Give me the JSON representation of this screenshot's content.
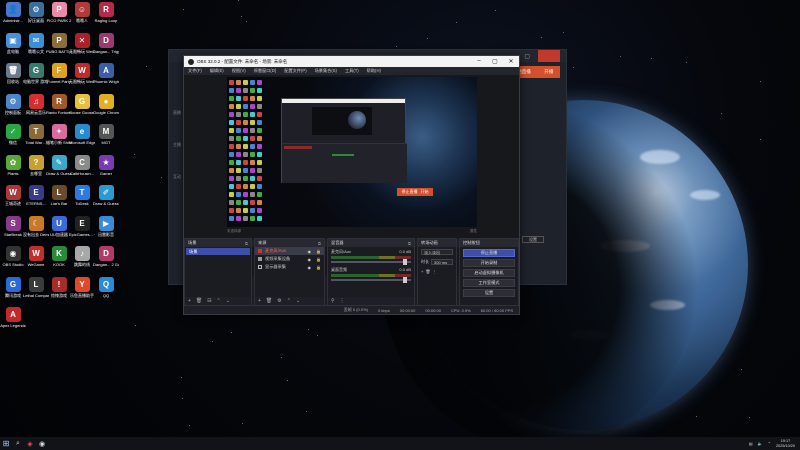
{
  "desktop": {
    "icons": [
      {
        "label": "Administr...",
        "glyph": "👤",
        "color": "#4a78c8"
      },
      {
        "label": "好压桌面",
        "glyph": "⚙",
        "color": "#3a6e9e"
      },
      {
        "label": "PICO PARK 2",
        "glyph": "P",
        "color": "#e88aa8"
      },
      {
        "label": "哦哦人",
        "glyph": "☺",
        "color": "#b03a3a"
      },
      {
        "label": "Raging Loop",
        "glyph": "R",
        "color": "#b52a4a"
      },
      {
        "label": "此电脑",
        "glyph": "▣",
        "color": "#4a90d9"
      },
      {
        "label": "哦哦公文",
        "glyph": "✉",
        "color": "#3a8fd6"
      },
      {
        "label": "PUBG BATTLEGR...",
        "glyph": "P",
        "color": "#8a6d3b"
      },
      {
        "label": "无限畅玩 WeGameB...",
        "glyph": "✕",
        "color": "#b0202a"
      },
      {
        "label": "Dangan... Trigger H...",
        "glyph": "D",
        "color": "#9b3a6e"
      },
      {
        "label": "回收站",
        "glyph": "🗑",
        "color": "#6a7a8a"
      },
      {
        "label": "电脑世界 游戏平台",
        "glyph": "G",
        "color": "#3a7a6e"
      },
      {
        "label": "Funmel Party",
        "glyph": "F",
        "color": "#e0a020"
      },
      {
        "label": "无限畅玩 WeGame...",
        "glyph": "W",
        "color": "#c02a2a"
      },
      {
        "label": "Phoenix Wright A...",
        "glyph": "A",
        "color": "#3a5ea8"
      },
      {
        "label": "控制面板",
        "glyph": "⚙",
        "color": "#4a86c8"
      },
      {
        "label": "网易云音乐",
        "glyph": "♫",
        "color": "#d23030"
      },
      {
        "label": "Ranto Fortune ...",
        "glyph": "R",
        "color": "#a05a2a"
      },
      {
        "label": "Goose Goose Duck",
        "glyph": "G",
        "color": "#e8c040"
      },
      {
        "label": "Google Chrome",
        "glyph": "●",
        "color": "#e0b020"
      },
      {
        "label": "微信",
        "glyph": "✓",
        "color": "#2aa845"
      },
      {
        "label": "Total War ...",
        "glyph": "T",
        "color": "#8a6a3a"
      },
      {
        "label": "蜡笔小新 Shifting...",
        "glyph": "✦",
        "color": "#d86aa0"
      },
      {
        "label": "Microsoft Edge",
        "glyph": "e",
        "color": "#2a8ad0"
      },
      {
        "label": "MGT",
        "glyph": "M",
        "color": "#555"
      },
      {
        "label": "Plants",
        "glyph": "✿",
        "color": "#5aa83a"
      },
      {
        "label": "去哪里",
        "glyph": "?",
        "color": "#c8a030"
      },
      {
        "label": "Draw & Guess",
        "glyph": "✎",
        "color": "#3aa8c8"
      },
      {
        "label": "CalbHousin...",
        "glyph": "C",
        "color": "#8a8a8a"
      },
      {
        "label": "Gamer",
        "glyph": "★",
        "color": "#7a3ab0"
      },
      {
        "label": "王城奇迹",
        "glyph": "W",
        "color": "#a83a3a"
      },
      {
        "label": "ETERNS...",
        "glyph": "E",
        "color": "#3a3a8a"
      },
      {
        "label": "Liar's Bar",
        "glyph": "L",
        "color": "#6a4a2a"
      },
      {
        "label": "ToDesk",
        "glyph": "T",
        "color": "#2a7ae0"
      },
      {
        "label": "Draw & Guess -...",
        "glyph": "✐",
        "color": "#2a9ad0"
      },
      {
        "label": "StarBreak",
        "glyph": "S",
        "color": "#8a3a8a"
      },
      {
        "label": "没有出去 Demo",
        "glyph": "☾",
        "color": "#c87a2a"
      },
      {
        "label": "UU加速器",
        "glyph": "U",
        "color": "#3a6ad8"
      },
      {
        "label": "EpicGames... 一站随交互",
        "glyph": "E",
        "color": "#222"
      },
      {
        "label": "迅雷影音",
        "glyph": "▶",
        "color": "#3a8ad8"
      },
      {
        "label": "OBS Studio",
        "glyph": "◉",
        "color": "#333"
      },
      {
        "label": "WeGame",
        "glyph": "W",
        "color": "#c0302a"
      },
      {
        "label": "KOOK",
        "glyph": "K",
        "color": "#2a8a3a"
      },
      {
        "label": "跳舞的线",
        "glyph": "♪",
        "color": "#a8a8a8"
      },
      {
        "label": "Dangan... 2 Goodb...",
        "glyph": "D",
        "color": "#b03a6a"
      },
      {
        "label": "腾讯游戏",
        "glyph": "G",
        "color": "#2a6ad8"
      },
      {
        "label": "Lethal Company",
        "glyph": "L",
        "color": "#3a3a3a"
      },
      {
        "label": "惊悚游戏",
        "glyph": "!",
        "color": "#a82a2a"
      },
      {
        "label": "乐鱼直播助手",
        "glyph": "Y",
        "color": "#e04a2a"
      },
      {
        "label": "QQ",
        "glyph": "Q",
        "color": "#2a8ad8"
      },
      {
        "label": "Apex Legends",
        "glyph": "A",
        "color": "#c02a2a"
      }
    ]
  },
  "background_window": {
    "side_labels": [
      "直播",
      "主播",
      "互动"
    ],
    "orange_buttons": [
      "开始直播",
      "开播"
    ],
    "settings_label": "设置"
  },
  "obs": {
    "title": "OBS 32.0.2 - 配置文件: 未命名 - 场景: 未命名",
    "menu": [
      "文件(F)",
      "编辑(E)",
      "视图(V)",
      "停靠窗口(D)",
      "配置文件(P)",
      "场景集合(S)",
      "工具(T)",
      "帮助(H)"
    ],
    "preview_status_left": "未选择源",
    "preview_status_right": "属性",
    "source_strip": {
      "label": "未选择源",
      "tabs": [
        "属性",
        "滤镜"
      ]
    },
    "scenes": {
      "title": "场景",
      "items": [
        "场景"
      ]
    },
    "sources": {
      "title": "来源",
      "items": [
        {
          "label": "麦克风/Aux",
          "selected": true
        },
        {
          "label": "视频采集设备",
          "selected": false
        },
        {
          "label": "显示器采集",
          "selected": false
        }
      ]
    },
    "mixer": {
      "title": "混音器",
      "channels": [
        {
          "name": "麦克风/Aux",
          "db": "0.0 dB"
        },
        {
          "name": "桌面音频",
          "db": "0.0 dB"
        }
      ]
    },
    "transitions": {
      "title": "转场动画",
      "type": "淡入淡出",
      "duration_label": "时长",
      "duration": "300 ms"
    },
    "controls": {
      "title": "控制按钮",
      "buttons": [
        {
          "label": "停止直播",
          "active": true
        },
        {
          "label": "开始录制",
          "active": false
        },
        {
          "label": "启动虚拟摄像机",
          "active": false
        },
        {
          "label": "工作室模式",
          "active": false
        },
        {
          "label": "设置",
          "active": false
        }
      ]
    },
    "status": {
      "frames": "丢帧 0 (0.0%)",
      "bitrate": "0 kbps",
      "stream_time": "00:00:00",
      "rec_time": "00:00:00",
      "cpu": "CPU: 0.9%",
      "fps": "60.00 / 60.00 FPS"
    },
    "nested_preview": {
      "rec_label": "停止直播",
      "rec_label2": "开始"
    }
  },
  "taskbar": {
    "time": "19:17",
    "date": "2025/10/20"
  }
}
